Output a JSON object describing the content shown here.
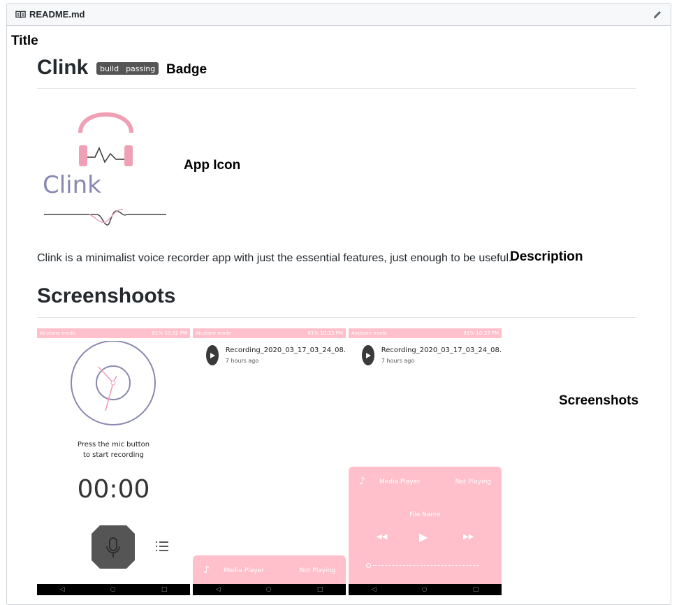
{
  "readme": {
    "filename": "README.md",
    "title": "Clink",
    "badge_left": "build",
    "badge_right": "passing",
    "logo_text": "Clink",
    "description": "Clink is a minimalist voice recorder app with just the essential features, just enough to be useful.",
    "screens_heading": "Screenshoots"
  },
  "annotations": {
    "title": "Title",
    "badge": "Badge",
    "app_icon": "App Icon",
    "description": "Description",
    "screenshots": "Screenshots"
  },
  "screens": {
    "status_left": "Airplane mode",
    "status_right_1": "81% 10:32 PM",
    "status_right_2": "81% 10:33 PM",
    "prompt_line1": "Press the mic button",
    "prompt_line2": "to start recording",
    "timer": "00:00",
    "recording_name": "Recording_2020_03_17_03_24_08.",
    "recording_time": "7 hours ago",
    "media_title": "Media Player",
    "media_status": "Not Playing",
    "file_name": "File Name"
  },
  "colors": {
    "accent_pink": "#ffc0cb",
    "logo_purple": "#8888b0"
  }
}
